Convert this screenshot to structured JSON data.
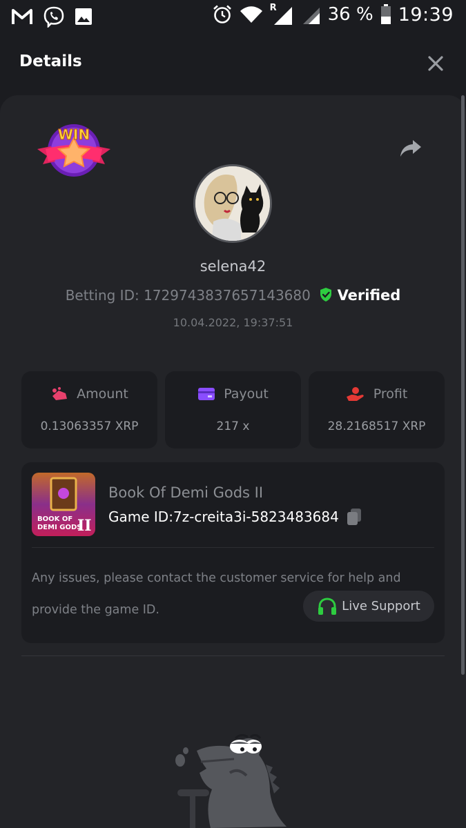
{
  "status_bar": {
    "battery_percent": "36 %",
    "time": "19:39",
    "roaming_indicator": "R",
    "icons": [
      "gmail-icon",
      "viber-icon",
      "gallery-icon",
      "alarm-icon",
      "wifi-icon",
      "signal-icon",
      "signal-icon-2",
      "battery-icon"
    ]
  },
  "header": {
    "title": "Details",
    "close_icon": "close-icon"
  },
  "bet": {
    "badge_text": "WIN",
    "username": "selena42",
    "betting_id_label": "Betting ID: 1729743837657143680",
    "verified_label": "Verified",
    "date": "10.04.2022, 19:37:51"
  },
  "stats": [
    {
      "label": "Amount",
      "value": "0.13063357 XRP",
      "icon": "amount-icon",
      "color": "#e8416d"
    },
    {
      "label": "Payout",
      "value": "217 x",
      "icon": "payout-card-icon",
      "color": "#8a4dff"
    },
    {
      "label": "Profit",
      "value": "28.2168517 XRP",
      "icon": "profit-hand-icon",
      "color": "#e53935"
    }
  ],
  "game": {
    "name": "Book Of Demi Gods II",
    "game_id": "Game ID:7z-creita3i-5823483684",
    "thumb_text_line1": "BOOK OF",
    "thumb_text_line2": "DEMI GODS",
    "thumb_text_numeral": "II",
    "issue_text": "Any issues, please contact the customer service for help and provide the game ID.",
    "live_support_label": "Live Support",
    "support_color": "#2ecc40"
  },
  "colors": {
    "background": "#1b1c20",
    "panel": "#232428",
    "verified_green": "#2ecc40"
  }
}
